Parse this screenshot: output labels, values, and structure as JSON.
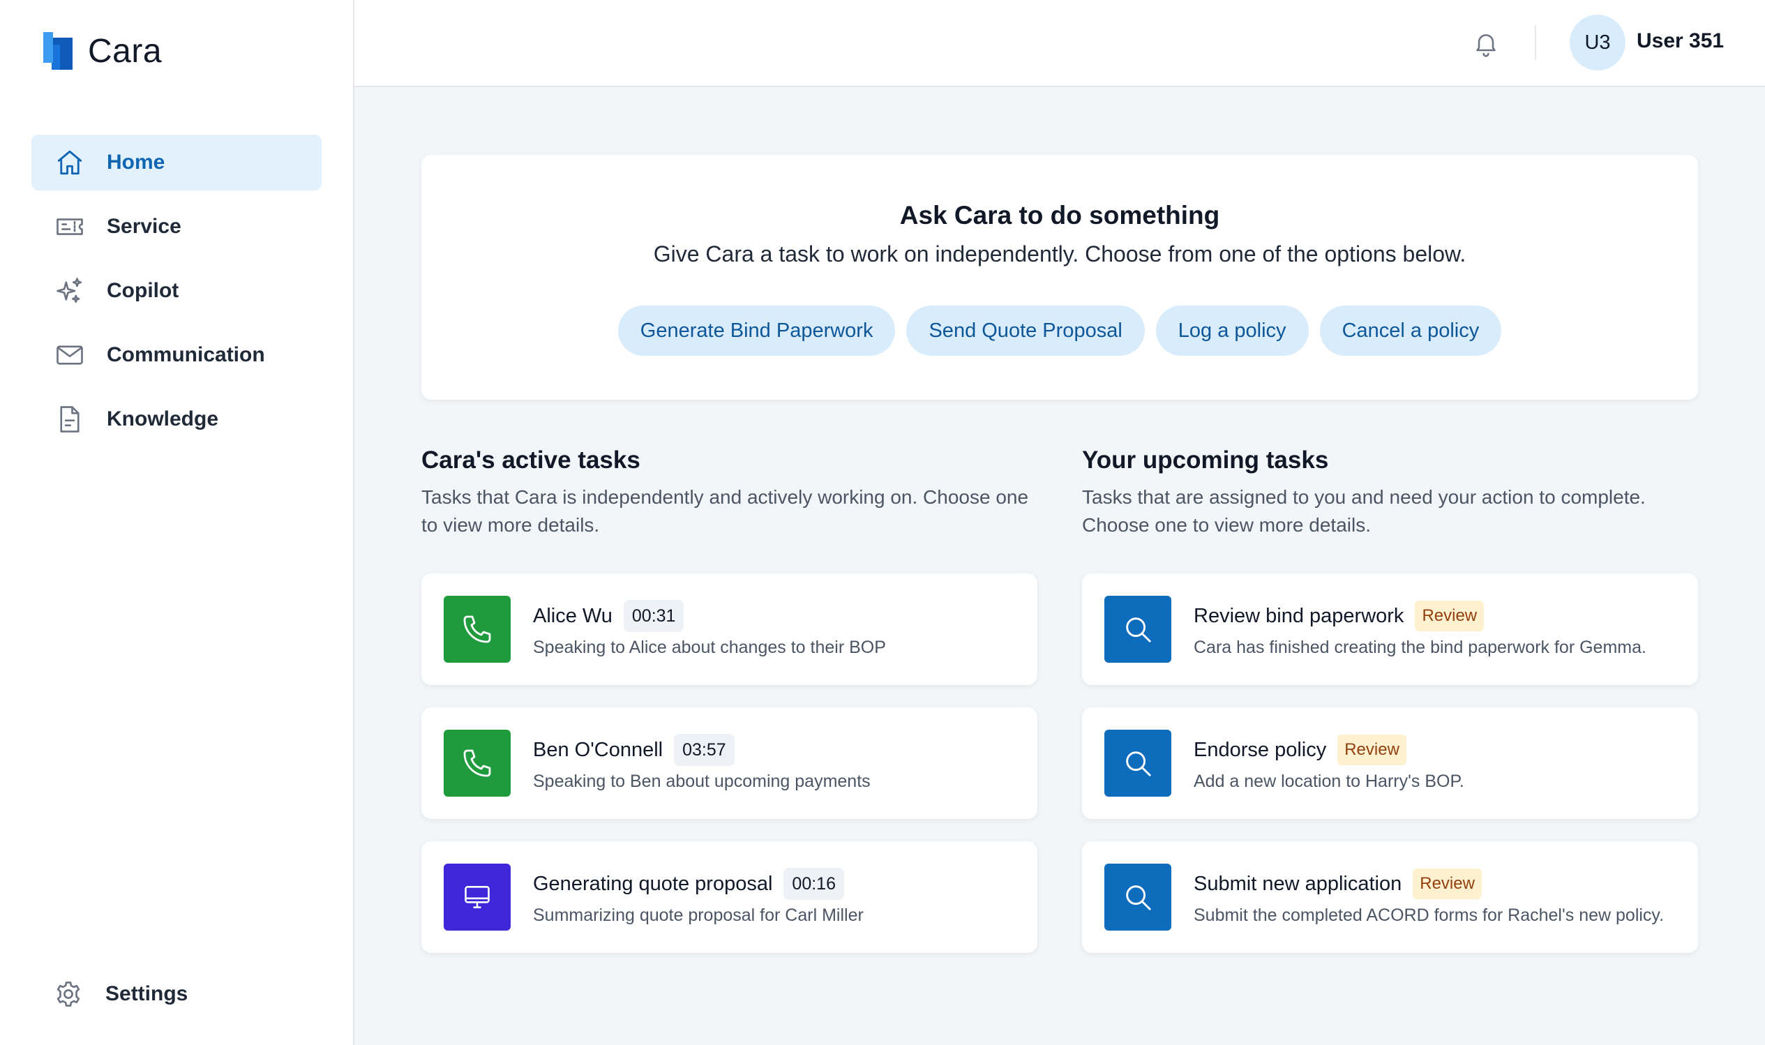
{
  "app": {
    "name": "Cara"
  },
  "sidebar": {
    "items": [
      {
        "label": "Home",
        "icon": "home-icon",
        "active": true
      },
      {
        "label": "Service",
        "icon": "ticket-icon",
        "active": false
      },
      {
        "label": "Copilot",
        "icon": "sparkles-icon",
        "active": false
      },
      {
        "label": "Communication",
        "icon": "envelope-icon",
        "active": false
      },
      {
        "label": "Knowledge",
        "icon": "document-icon",
        "active": false
      }
    ],
    "settings_label": "Settings"
  },
  "topbar": {
    "avatar_initials": "U3",
    "username": "User 351"
  },
  "ask": {
    "title": "Ask Cara to do something",
    "subtitle": "Give Cara a task to work on independently. Choose from one of the options below.",
    "buttons": [
      "Generate Bind Paperwork",
      "Send Quote Proposal",
      "Log a policy",
      "Cancel a policy"
    ]
  },
  "active": {
    "title": "Cara's active tasks",
    "description": "Tasks that Cara is independently and actively working on. Choose one to view more details.",
    "tasks": [
      {
        "title": "Alice Wu",
        "timer": "00:31",
        "desc": "Speaking to Alice about changes to their BOP",
        "icon": "phone-icon",
        "color": "#1f9a3c"
      },
      {
        "title": "Ben O'Connell",
        "timer": "03:57",
        "desc": "Speaking to Ben about upcoming payments",
        "icon": "phone-icon",
        "color": "#1f9a3c"
      },
      {
        "title": "Generating quote proposal",
        "timer": "00:16",
        "desc": "Summarizing quote proposal for Carl Miller",
        "icon": "monitor-icon",
        "color": "#3f26d9"
      }
    ]
  },
  "upcoming": {
    "title": "Your upcoming tasks",
    "description": "Tasks that are assigned to you and need your action to complete. Choose one to view more details.",
    "tasks": [
      {
        "title": "Review bind paperwork",
        "badge": "Review",
        "desc": "Cara has finished creating the bind paperwork for Gemma.",
        "icon": "search-icon",
        "color": "#0e6cbd"
      },
      {
        "title": "Endorse policy",
        "badge": "Review",
        "desc": "Add a new location to Harry's BOP.",
        "icon": "search-icon",
        "color": "#0e6cbd"
      },
      {
        "title": "Submit new application",
        "badge": "Review",
        "desc": "Submit the completed ACORD forms for Rachel's new policy.",
        "icon": "search-icon",
        "color": "#0e6cbd"
      }
    ]
  },
  "colors": {
    "accent": "#0e65b1",
    "active_nav_bg": "#e3f1fc",
    "pill_bg": "#d9ecfb",
    "badge_bg": "#fdf1cf",
    "badge_text": "#92400e"
  }
}
